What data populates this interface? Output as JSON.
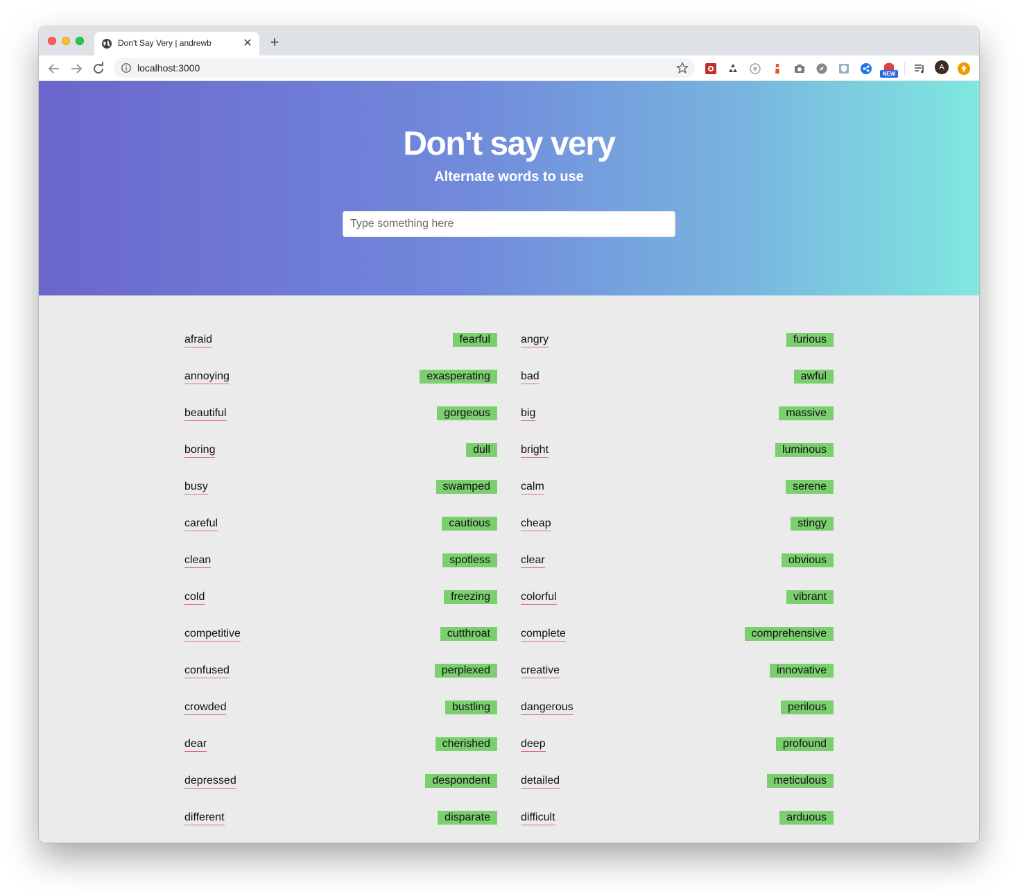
{
  "browser": {
    "tab_title": "Don't Say Very | andrewb",
    "new_tab_label": "+",
    "close_label": "✕",
    "url": "localhost:3000",
    "avatar_letter": "A",
    "extension_badge": "NEW"
  },
  "hero": {
    "title": "Don't say very",
    "subtitle": "Alternate words to use",
    "search_placeholder": "Type something here"
  },
  "pairs": [
    {
      "word": "afraid",
      "alt": "fearful"
    },
    {
      "word": "angry",
      "alt": "furious"
    },
    {
      "word": "annoying",
      "alt": "exasperating"
    },
    {
      "word": "bad",
      "alt": "awful"
    },
    {
      "word": "beautiful",
      "alt": "gorgeous"
    },
    {
      "word": "big",
      "alt": "massive"
    },
    {
      "word": "boring",
      "alt": "dull"
    },
    {
      "word": "bright",
      "alt": "luminous"
    },
    {
      "word": "busy",
      "alt": "swamped"
    },
    {
      "word": "calm",
      "alt": "serene"
    },
    {
      "word": "careful",
      "alt": "cautious"
    },
    {
      "word": "cheap",
      "alt": "stingy"
    },
    {
      "word": "clean",
      "alt": "spotless"
    },
    {
      "word": "clear",
      "alt": "obvious"
    },
    {
      "word": "cold",
      "alt": "freezing"
    },
    {
      "word": "colorful",
      "alt": "vibrant"
    },
    {
      "word": "competitive",
      "alt": "cutthroat"
    },
    {
      "word": "complete",
      "alt": "comprehensive"
    },
    {
      "word": "confused",
      "alt": "perplexed"
    },
    {
      "word": "creative",
      "alt": "innovative"
    },
    {
      "word": "crowded",
      "alt": "bustling"
    },
    {
      "word": "dangerous",
      "alt": "perilous"
    },
    {
      "word": "dear",
      "alt": "cherished"
    },
    {
      "word": "deep",
      "alt": "profound"
    },
    {
      "word": "depressed",
      "alt": "despondent"
    },
    {
      "word": "detailed",
      "alt": "meticulous"
    },
    {
      "word": "different",
      "alt": "disparate"
    },
    {
      "word": "difficult",
      "alt": "arduous"
    }
  ]
}
